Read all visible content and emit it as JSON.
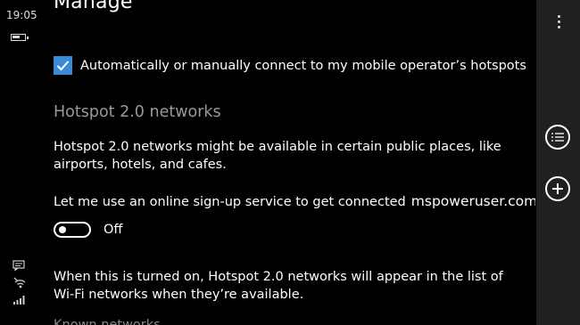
{
  "status_bar": {
    "time": "19:05",
    "icons": [
      "battery-icon",
      "message-icon",
      "wifi-icon",
      "signal-icon"
    ]
  },
  "page": {
    "title": "Manage",
    "checkbox": {
      "label": "Automatically or manually connect to my mobile operator’s hotspots",
      "checked": true,
      "color": "#3b8ad8"
    },
    "section_heading": "Hotspot 2.0 networks",
    "description": "Hotspot 2.0 networks might be available in certain public places, like airports, hotels, and cafes.",
    "signup_label": "Let me use an online sign-up service to get connected",
    "watermark": "mspoweruser.com",
    "toggle": {
      "state": "Off",
      "on": false
    },
    "note": "When this is turned on, Hotspot 2.0 networks will appear in the list of Wi-Fi networks when they’re available.",
    "cutoff_text": "Known networks"
  },
  "app_bar": {
    "buttons": [
      "more-icon",
      "select-icon",
      "add-icon"
    ],
    "background": "#202020"
  }
}
